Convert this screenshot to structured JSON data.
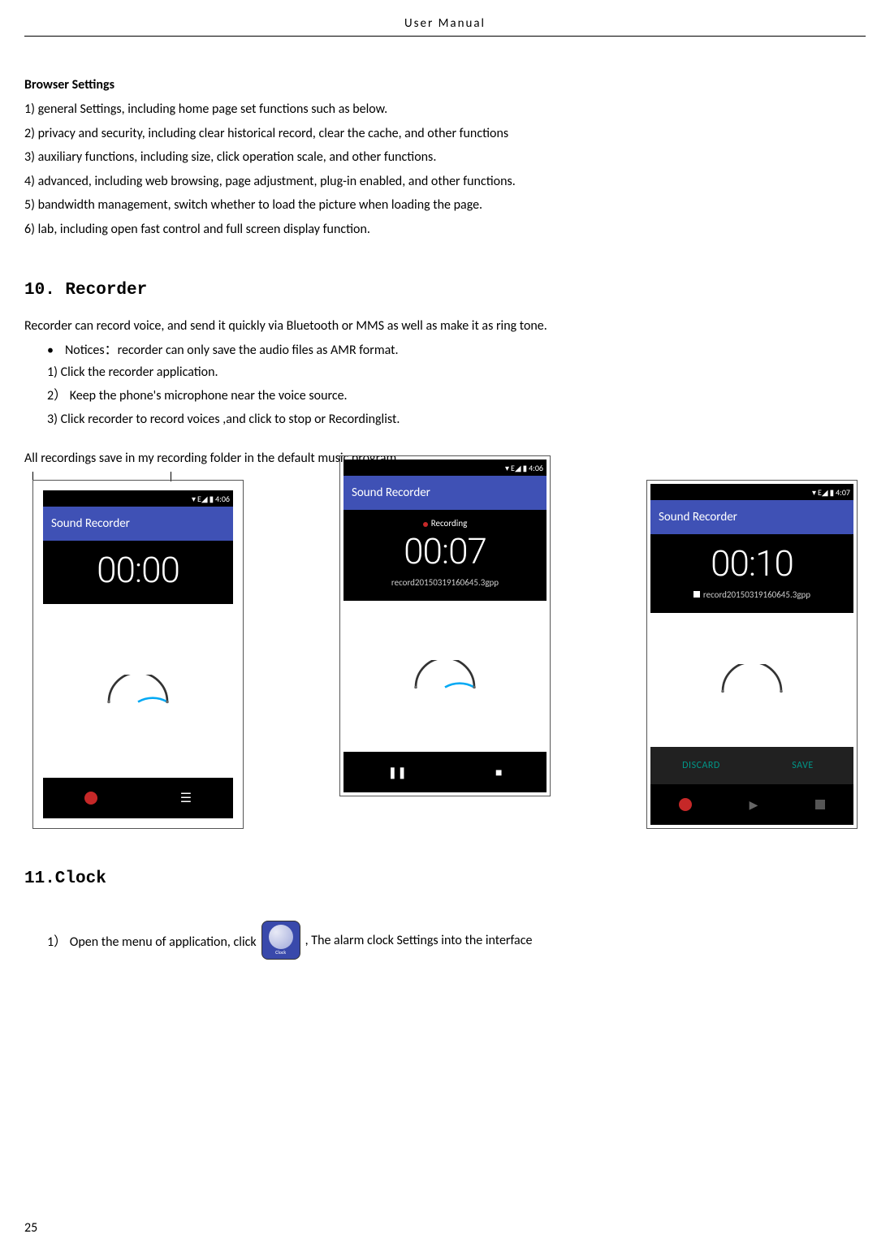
{
  "header": "User    Manual",
  "browser": {
    "title": "Browser Settings",
    "items": [
      "1) general Settings, including home page set functions such as below.",
      "2) privacy and security, including clear historical record, clear the cache, and other functions",
      "3) auxiliary functions, including size, click operation scale, and other functions.",
      "4) advanced, including web browsing, page adjustment, plug-in enabled, and other functions.",
      "5) bandwidth management, switch whether to load the picture when loading the page.",
      "6) lab, including open fast control and full screen display function."
    ]
  },
  "recorder": {
    "heading": "10.  Recorder",
    "intro": "Recorder can record voice, and send it quickly via Bluetooth or MMS as well as make it as ring tone.",
    "notice": "Notices：recorder can only save the audio files as AMR format.",
    "steps": [
      "1) Click the recorder application.",
      "2） Keep the phone's microphone near the voice source.",
      "3) Click recorder to record voices ,and click to stop or Recordinglist."
    ],
    "folder_note": "All recordings save in my recording folder in the default music program."
  },
  "screens": {
    "s1": {
      "time": "4:06",
      "title": "Sound Recorder",
      "timer": "00:00"
    },
    "s2": {
      "time": "4:06",
      "title": "Sound Recorder",
      "rec_label": "Recording",
      "timer": "00:07",
      "file": "record20150319160645.3gpp"
    },
    "s3": {
      "time": "4:07",
      "title": "Sound Recorder",
      "timer": "00:10",
      "file": "record20150319160645.3gpp",
      "discard": "DISCARD",
      "save": "SAVE"
    }
  },
  "clock": {
    "heading": "11.Clock",
    "prefix": "1） Open the menu of application, click",
    "icon_label": "Clock",
    "suffix": ",  The alarm clock Settings into the interface"
  },
  "page_num": "25"
}
